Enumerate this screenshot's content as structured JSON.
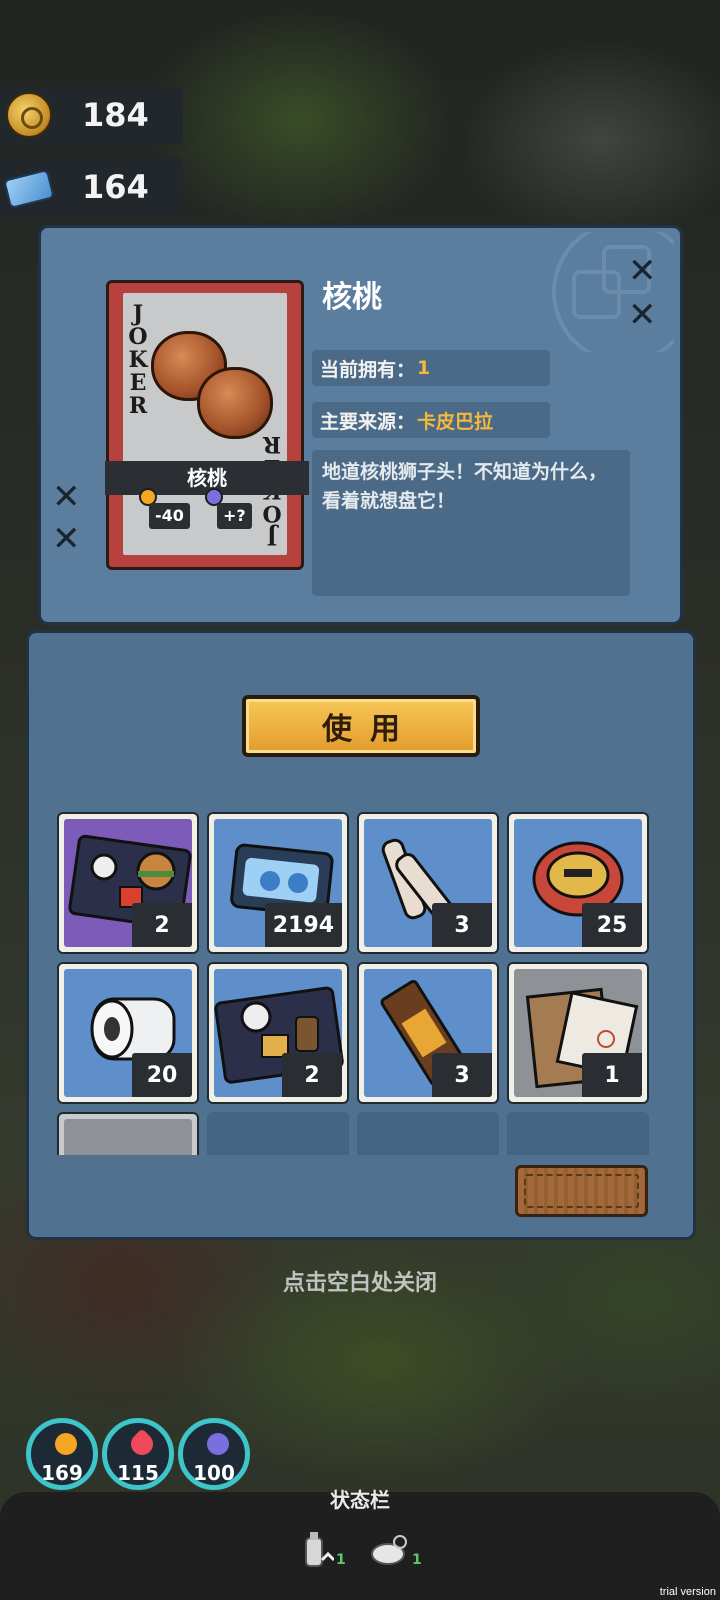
{
  "currency": {
    "coins": {
      "icon": "gold-coin-icon",
      "value": "184"
    },
    "tickets": {
      "icon": "blue-ticket-icon",
      "value": "164"
    }
  },
  "item_detail": {
    "title": "核桃",
    "card": {
      "side_text": "JOKER",
      "name": "核桃",
      "stat_hunger": "-40",
      "stat_mind": "+?"
    },
    "owned_label": "当前拥有：",
    "owned_value": "1",
    "source_label": "主要来源：",
    "source_value": "卡皮巴拉",
    "description": "地道核桃狮子头！不知道为什么，看着就想盘它！"
  },
  "use_button": "使用",
  "inventory": [
    {
      "name": "fast-food-pack-icon",
      "count": "2"
    },
    {
      "name": "blue-snack-pack-icon",
      "count": "2194"
    },
    {
      "name": "bone-bundle-icon",
      "count": "3"
    },
    {
      "name": "round-badge-cake-icon",
      "count": "25"
    },
    {
      "name": "toilet-paper-roll-icon",
      "count": "20"
    },
    {
      "name": "bun-drink-pack-icon",
      "count": "2"
    },
    {
      "name": "chocolate-bar-icon",
      "count": "3"
    },
    {
      "name": "document-envelope-icon",
      "count": "1"
    }
  ],
  "close_hint": "点击空白处关闭",
  "gauges": [
    {
      "icon": "hunger-icon",
      "value": "169",
      "color": "#f5a623"
    },
    {
      "icon": "health-heart-icon",
      "value": "115",
      "color": "#f04a5a"
    },
    {
      "icon": "brain-icon",
      "value": "100",
      "color": "#7b6fe0"
    }
  ],
  "status_bar": {
    "title": "状态栏",
    "effects": [
      {
        "icon": "bottle-buff-icon",
        "level": "1"
      },
      {
        "icon": "rest-cloud-buff-icon",
        "level": "1"
      }
    ]
  },
  "watermark": "trial version"
}
